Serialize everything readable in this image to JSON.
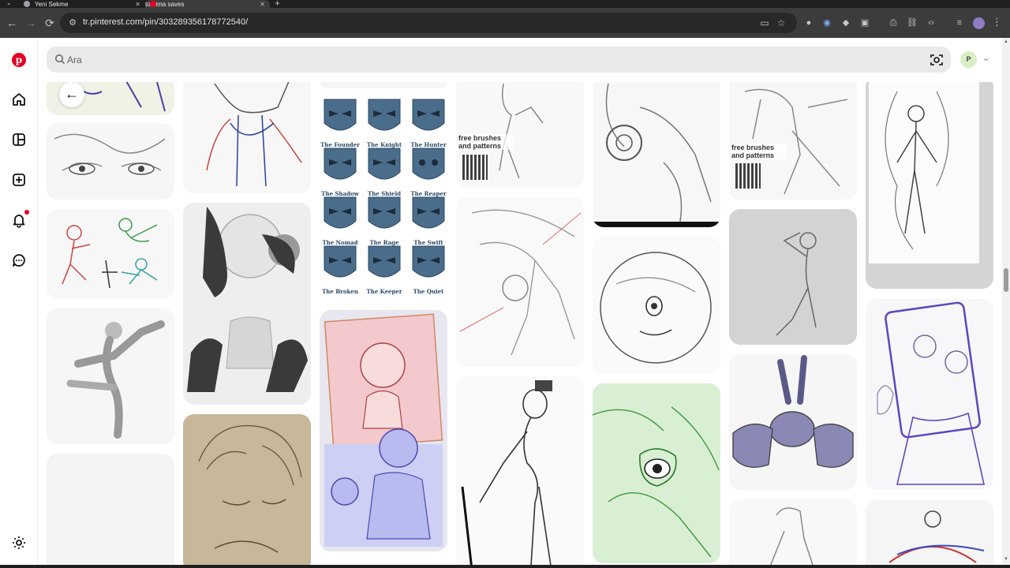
{
  "browser": {
    "tabs": [
      {
        "title": "Yeni Sekme",
        "active": false
      },
      {
        "title": "tomima saves",
        "active": true
      }
    ],
    "url": "tr.pinterest.com/pin/303289356178772540/"
  },
  "icons": {
    "back": "←",
    "forward": "→",
    "reload": "⟳",
    "site_info": "⚙",
    "new_tab": "+",
    "close": "✕",
    "kebab": "⋮",
    "cast": "▭",
    "star": "☆",
    "print": "⎙",
    "link": "⛓",
    "code": "‹›",
    "account_chevron": "⌄",
    "pin_letter": "p"
  },
  "search": {
    "placeholder": "Ara",
    "value": ""
  },
  "account": {
    "initial": "P"
  },
  "pins": {
    "mask_labels": [
      "The Founder",
      "The Knight",
      "The Hunter",
      "The Shadow",
      "The Shield",
      "The Reaper",
      "The Nomad",
      "The Rage",
      "The Swift",
      "The Broken",
      "The Keeper",
      "The Quiet"
    ],
    "brush_promo_1": "free brushes and patterns",
    "brush_promo_2": "free brushes and patterns"
  },
  "colors": {
    "brand": "#e60023",
    "chrome_dark": "#3c3c3c",
    "mask_blue": "#4a6d8c",
    "pink_sketch": "#f4c9cd",
    "lavender_sketch": "#cdd0f4",
    "green_sketch": "#d9efd4",
    "tan_sketch": "#c9b79a"
  }
}
